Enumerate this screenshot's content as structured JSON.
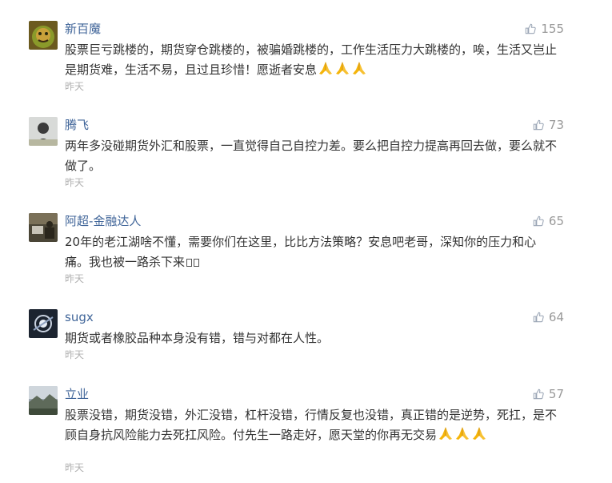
{
  "comments": [
    {
      "username": "新百魔",
      "likes": "155",
      "text": "股票巨亏跳楼的，期货穿仓跳楼的，被骗婚跳楼的，工作生活压力大跳楼的，唉，生活又岂止是期货难，生活不易，且过且珍惜！愿逝者安息",
      "time": "昨天",
      "emoji_count": 3
    },
    {
      "username": "腾飞",
      "likes": "73",
      "text": "两年多没碰期货外汇和股票，一直觉得自己自控力差。要么把自控力提高再回去做，要么就不做了。",
      "time": "昨天",
      "emoji_count": 0
    },
    {
      "username": "阿超-金融达人",
      "likes": "65",
      "text": "20年的老江湖啥不懂，需要你们在这里，比比方法策略？安息吧老哥，深知你的压力和心痛。我也被一路杀下来",
      "text_suffix": "",
      "time": "昨天",
      "emoji_count": 0
    },
    {
      "username": "sugx",
      "likes": "64",
      "text": "期货或者橡胶品种本身没有错，错与对都在人性。",
      "time": "昨天",
      "emoji_count": 0
    },
    {
      "username": "立业",
      "likes": "57",
      "text": "股票没错，期货没错，外汇没错，杠杆没错，行情反复也没错，真正错的是逆势，死扛，是不顾自身抗风险能力去死扛风险。付先生一路走好，愿天堂的你再无交易",
      "time": "昨天",
      "emoji_count": 3
    }
  ],
  "icons": {
    "like": "thumbs-up-icon",
    "emoji": "folded-hands-emoji"
  },
  "colors": {
    "username": "#406599",
    "text": "#333333",
    "meta": "#999999",
    "emoji": "#f5b50a"
  }
}
